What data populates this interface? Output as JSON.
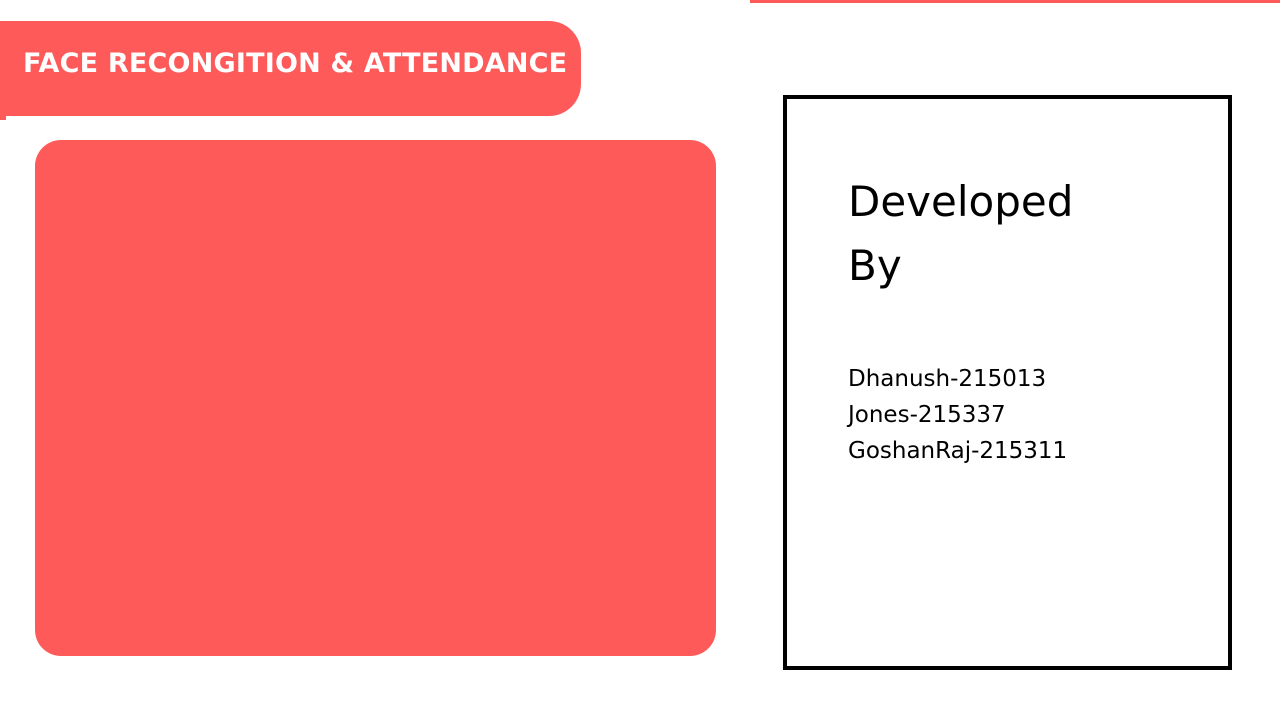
{
  "app": {
    "title": "FACE RECONGITION & ATTENDANCE"
  },
  "credits": {
    "heading_line1": "Developed",
    "heading_line2": "By",
    "developers": [
      "Dhanush-215013",
      "Jones-215337",
      "GoshanRaj-215311"
    ]
  },
  "colors": {
    "accent": "#ff5a5a",
    "panel_shadow": "#6a5cff",
    "text_on_accent": "#ffffff",
    "box_border": "#000000"
  }
}
